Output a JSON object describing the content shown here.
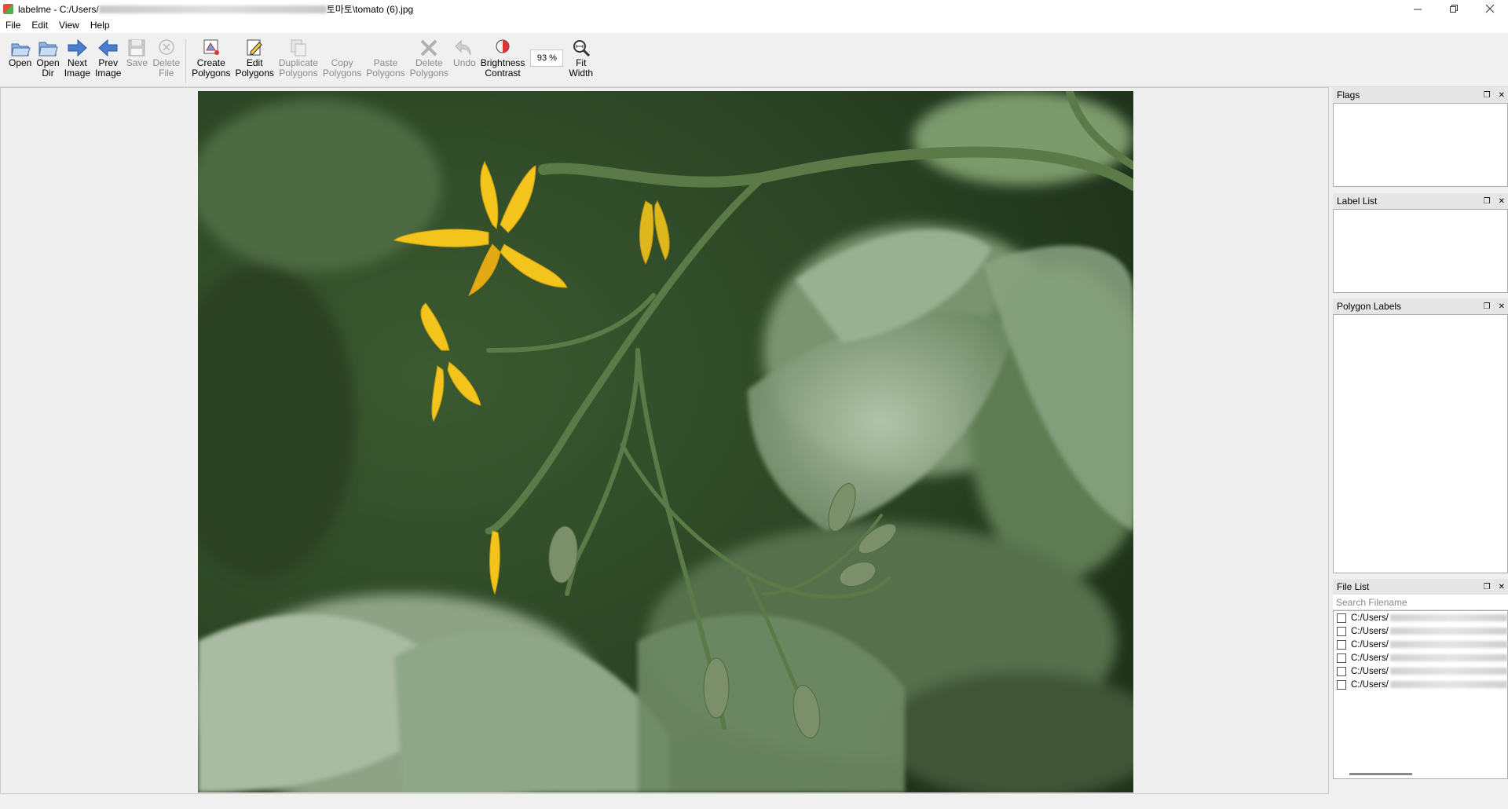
{
  "window": {
    "title_prefix": "labelme - C:/Users/",
    "title_suffix": "토마토\\tomato (6).jpg",
    "controls": [
      "minimize",
      "restore",
      "close"
    ]
  },
  "menu": [
    "File",
    "Edit",
    "View",
    "Help"
  ],
  "toolbar": {
    "open": "Open",
    "open_dir": "Open\nDir",
    "next_image": "Next\nImage",
    "prev_image": "Prev\nImage",
    "save": "Save",
    "delete_file": "Delete\nFile",
    "create_polygons": "Create\nPolygons",
    "edit_polygons": "Edit\nPolygons",
    "duplicate_polygons": "Duplicate\nPolygons",
    "copy_polygons": "Copy\nPolygons",
    "paste_polygons": "Paste\nPolygons",
    "delete_polygons": "Delete\nPolygons",
    "undo": "Undo",
    "brightness_contrast": "Brightness\nContrast",
    "zoom": "93 %",
    "fit_width": "Fit\nWidth"
  },
  "docks": {
    "flags": "Flags",
    "label_list": "Label List",
    "polygon_labels": "Polygon Labels",
    "file_list": "File List",
    "search_placeholder": "Search Filename"
  },
  "file_list": [
    {
      "path": "C:/Users/",
      "checked": false
    },
    {
      "path": "C:/Users/",
      "checked": false
    },
    {
      "path": "C:/Users/",
      "checked": false
    },
    {
      "path": "C:/Users/",
      "checked": false
    },
    {
      "path": "C:/Users/",
      "checked": false
    },
    {
      "path": "C:/Users/",
      "checked": false
    }
  ],
  "colors": {
    "flower_yellow": "#f2c41c",
    "leaf_green": "#5f7f4e",
    "bg_dark_green": "#2f4a28"
  }
}
